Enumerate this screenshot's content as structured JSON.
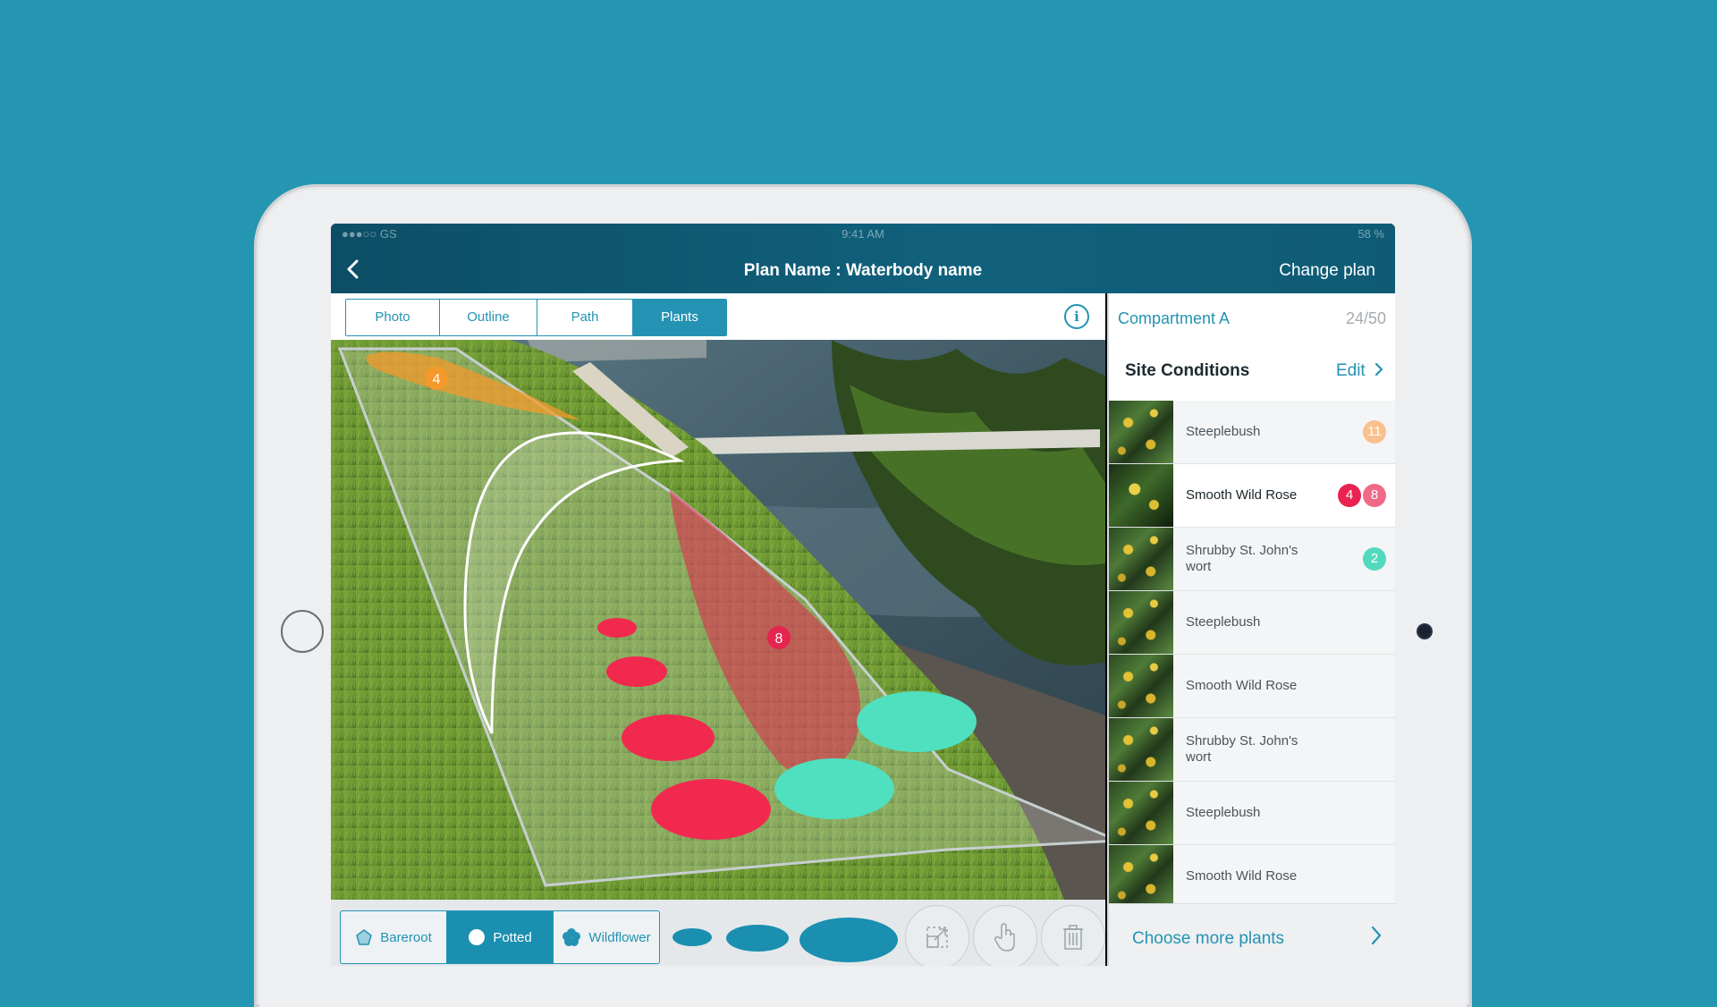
{
  "status_bar": {
    "carrier": "●●●○○ GS",
    "time": "9:41 AM",
    "battery": "58 %"
  },
  "header": {
    "back_icon": "chevron-left-icon",
    "title": "Plan Name : Waterbody name",
    "change_plan_label": "Change plan"
  },
  "toolbar": {
    "tabs": [
      {
        "label": "Photo",
        "active": false
      },
      {
        "label": "Outline",
        "active": false
      },
      {
        "label": "Path",
        "active": false
      },
      {
        "label": "Plants",
        "active": true
      }
    ],
    "info_icon": "info-icon",
    "info_glyph": "i"
  },
  "canvas": {
    "region_labels": [
      {
        "label": "4",
        "color": "#f39a2b"
      },
      {
        "label": "8",
        "color": "#e5244f"
      }
    ]
  },
  "bottom_toolbar": {
    "plant_types": [
      {
        "label": "Bareroot",
        "icon": "pentagon-icon",
        "active": false
      },
      {
        "label": "Potted",
        "icon": "circle-icon",
        "active": true
      },
      {
        "label": "Wildflower",
        "icon": "flower-icon",
        "active": false
      }
    ],
    "sizes": [
      "small",
      "medium",
      "large"
    ],
    "tools": [
      "resize-icon",
      "hand-pointer-icon",
      "trash-icon"
    ]
  },
  "sidebar": {
    "compartment_name": "Compartment A",
    "compartment_count": "24/50",
    "site_conditions_title": "Site Conditions",
    "edit_label": "Edit",
    "plants": [
      {
        "name": "Steeplebush",
        "badges": [
          {
            "label": "11",
            "color": "#f7c28f"
          }
        ]
      },
      {
        "name": "Smooth Wild Rose",
        "selected": true,
        "badges": [
          {
            "label": "4",
            "color": "#e9234f"
          },
          {
            "label": "8",
            "color": "#f06a88"
          }
        ]
      },
      {
        "name": "Shrubby St. John's wort",
        "badges": [
          {
            "label": "2",
            "color": "#52d9bd"
          }
        ]
      },
      {
        "name": "Steeplebush",
        "badges": []
      },
      {
        "name": "Smooth Wild Rose",
        "badges": []
      },
      {
        "name": "Shrubby St. John's wort",
        "badges": []
      },
      {
        "name": "Steeplebush",
        "badges": []
      },
      {
        "name": "Smooth Wild Rose",
        "badges": []
      }
    ],
    "choose_more_label": "Choose more plants"
  },
  "colors": {
    "accent": "#2493b3",
    "header": "#0f5a74",
    "background": "#2596b1",
    "potted_red": "#f2294f",
    "potted_teal": "#4fe0bf",
    "region_orange": "#f39a2b"
  }
}
